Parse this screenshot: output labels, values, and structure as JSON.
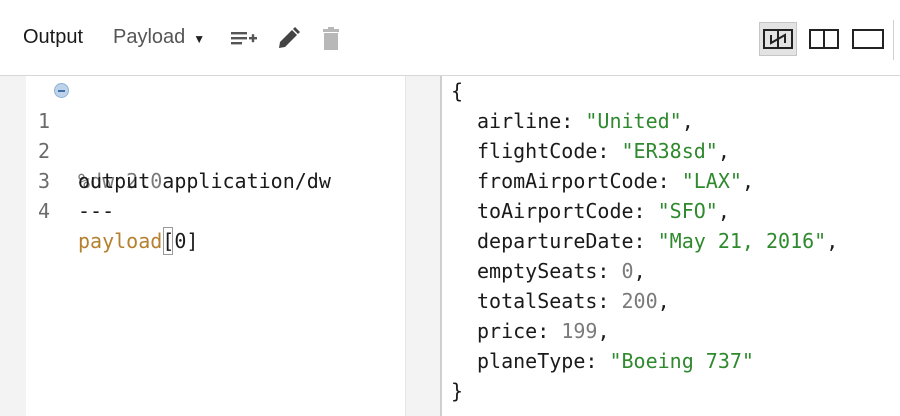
{
  "toolbar": {
    "title": "Output",
    "target": "Payload",
    "icons": [
      "add-list-icon",
      "pencil-icon",
      "trash-icon"
    ],
    "views": [
      "view-split-active-icon",
      "view-two-columns-icon",
      "view-single-icon"
    ]
  },
  "editor": {
    "lines": [
      {
        "num": "1",
        "text": "%dw 2.0"
      },
      {
        "num": "2",
        "text": "output application/dw"
      },
      {
        "num": "3",
        "text": "---"
      },
      {
        "num": "4",
        "payload": "payload",
        "bracket_open": "[",
        "index": "0",
        "bracket_close": "]"
      }
    ]
  },
  "output": {
    "open": "{",
    "close": "}",
    "fields": [
      {
        "key": "airline",
        "value": "\"United\"",
        "kind": "string",
        "comma": ","
      },
      {
        "key": "flightCode",
        "value": "\"ER38sd\"",
        "kind": "string",
        "comma": ","
      },
      {
        "key": "fromAirportCode",
        "value": "\"LAX\"",
        "kind": "string",
        "comma": ","
      },
      {
        "key": "toAirportCode",
        "value": "\"SFO\"",
        "kind": "string",
        "comma": ","
      },
      {
        "key": "departureDate",
        "value": "\"May 21, 2016\"",
        "kind": "string",
        "comma": ","
      },
      {
        "key": "emptySeats",
        "value": "0",
        "kind": "number",
        "comma": ","
      },
      {
        "key": "totalSeats",
        "value": "200",
        "kind": "number",
        "comma": ","
      },
      {
        "key": "price",
        "value": "199",
        "kind": "number",
        "comma": ","
      },
      {
        "key": "planeType",
        "value": "\"Boeing 737\"",
        "kind": "string",
        "comma": ""
      }
    ]
  },
  "colors": {
    "string": "#2f8a2f",
    "number": "#7a7a7a",
    "payload": "#b5812f",
    "directive": "#7a7a7a"
  }
}
